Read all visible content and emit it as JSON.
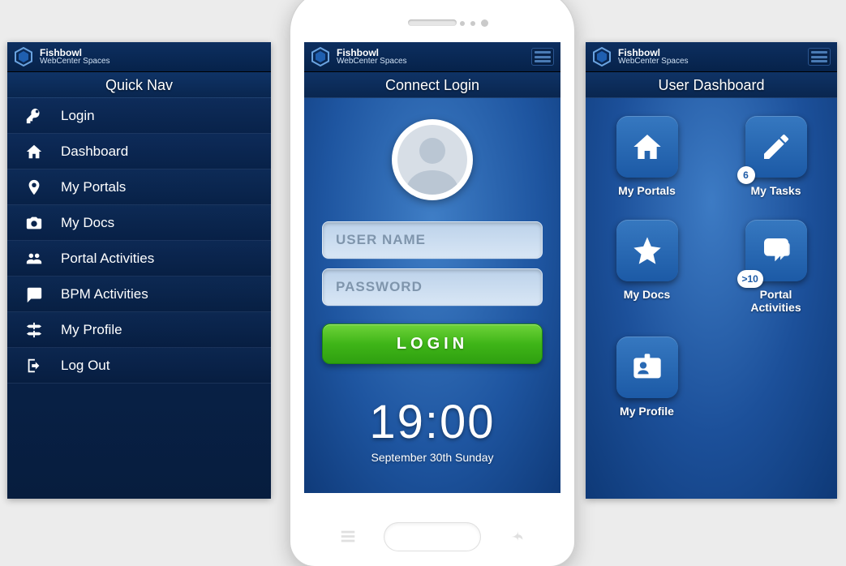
{
  "app": {
    "name": "Fishbowl",
    "subtitle": "WebCenter Spaces"
  },
  "quicknav": {
    "header": "Quick Nav",
    "items": [
      {
        "icon": "key-icon",
        "label": "Login"
      },
      {
        "icon": "home-icon",
        "label": "Dashboard"
      },
      {
        "icon": "pin-icon",
        "label": "My Portals"
      },
      {
        "icon": "camera-icon",
        "label": "My Docs"
      },
      {
        "icon": "group-icon",
        "label": "Portal Activities"
      },
      {
        "icon": "comment-icon",
        "label": "BPM Activities"
      },
      {
        "icon": "signpost-icon",
        "label": "My Profile"
      },
      {
        "icon": "logout-icon",
        "label": "Log Out"
      }
    ]
  },
  "login": {
    "header": "Connect Login",
    "username_placeholder": "USER NAME",
    "password_placeholder": "PASSWORD",
    "button": "LOGIN",
    "time": "19:00",
    "date": "September 30th Sunday"
  },
  "dashboard": {
    "header": "User Dashboard",
    "tiles": [
      {
        "icon": "home-icon",
        "label": "My Portals"
      },
      {
        "icon": "pencil-icon",
        "label": "My Tasks",
        "badge": "6"
      },
      {
        "icon": "star-icon",
        "label": "My Docs"
      },
      {
        "icon": "chat-icon",
        "label": "Portal Activities",
        "badge": ">10"
      },
      {
        "icon": "idcard-icon",
        "label": "My Profile"
      }
    ]
  },
  "colors": {
    "accent": "#3fb518",
    "brand": "#1c5aa6"
  }
}
